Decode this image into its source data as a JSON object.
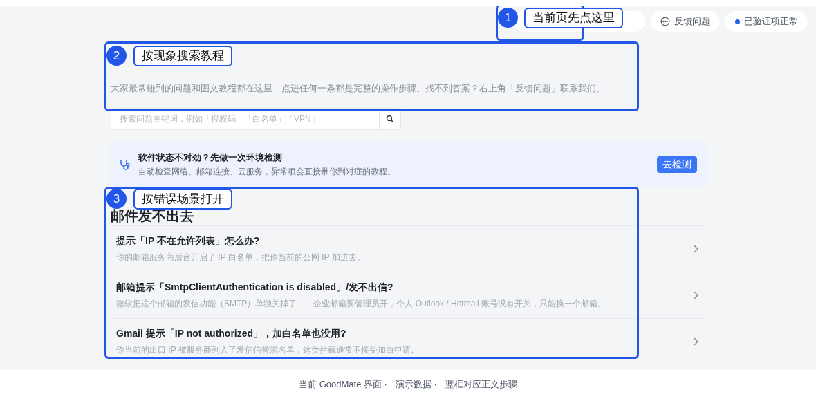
{
  "header": {
    "buttons": [
      {
        "kind": "hidden"
      },
      {
        "kind": "feedback",
        "label": "反馈问题"
      },
      {
        "kind": "status",
        "label": "已验证项正常",
        "color": "#2563eb"
      }
    ]
  },
  "intro": {
    "description": "大家最常碰到的问题和图文教程都在这里，点进任何一条都是完整的操作步骤。找不到答案？右上角「反馈问题」联系我们。",
    "search": {
      "placeholder": "搜索问题关键词，例如「授权码」「白名单」「VPN」"
    }
  },
  "check_banner": {
    "title": "软件状态不对劲？先做一次环境检测",
    "subtitle": "自动检查网络、邮箱连接、云服务，异常项会直接带你到对症的教程。",
    "button": "去检测"
  },
  "section": {
    "title": "邮件发不出去",
    "items": [
      {
        "title": "提示「IP 不在允许列表」怎么办?",
        "subtitle": "你的邮箱服务商后台开启了 IP 白名单，把你当前的公网 IP 加进去。"
      },
      {
        "title": "邮箱提示「SmtpClientAuthentication is disabled」/发不出信?",
        "subtitle": "微软把这个邮箱的发信功能（SMTP）单独关掉了——企业邮箱要管理员开，个人 Outlook / Hotmail 账号没有开关，只能换一个邮箱。"
      },
      {
        "title": "Gmail 提示「IP not authorized」，加白名单也没用?",
        "subtitle": "你当前的出口 IP 被服务商列入了发信信誉黑名单，这类拦截通常不接受加白申请。"
      }
    ]
  },
  "annotations": [
    {
      "number": "1",
      "label": "当前页先点这里"
    },
    {
      "number": "2",
      "label": "按现象搜索教程"
    },
    {
      "number": "3",
      "label": "按错误场景打开"
    }
  ],
  "footer": [
    "当前 GoodMate 界面 ·",
    "演示数据 ·",
    "蓝框对应正文步骤"
  ]
}
